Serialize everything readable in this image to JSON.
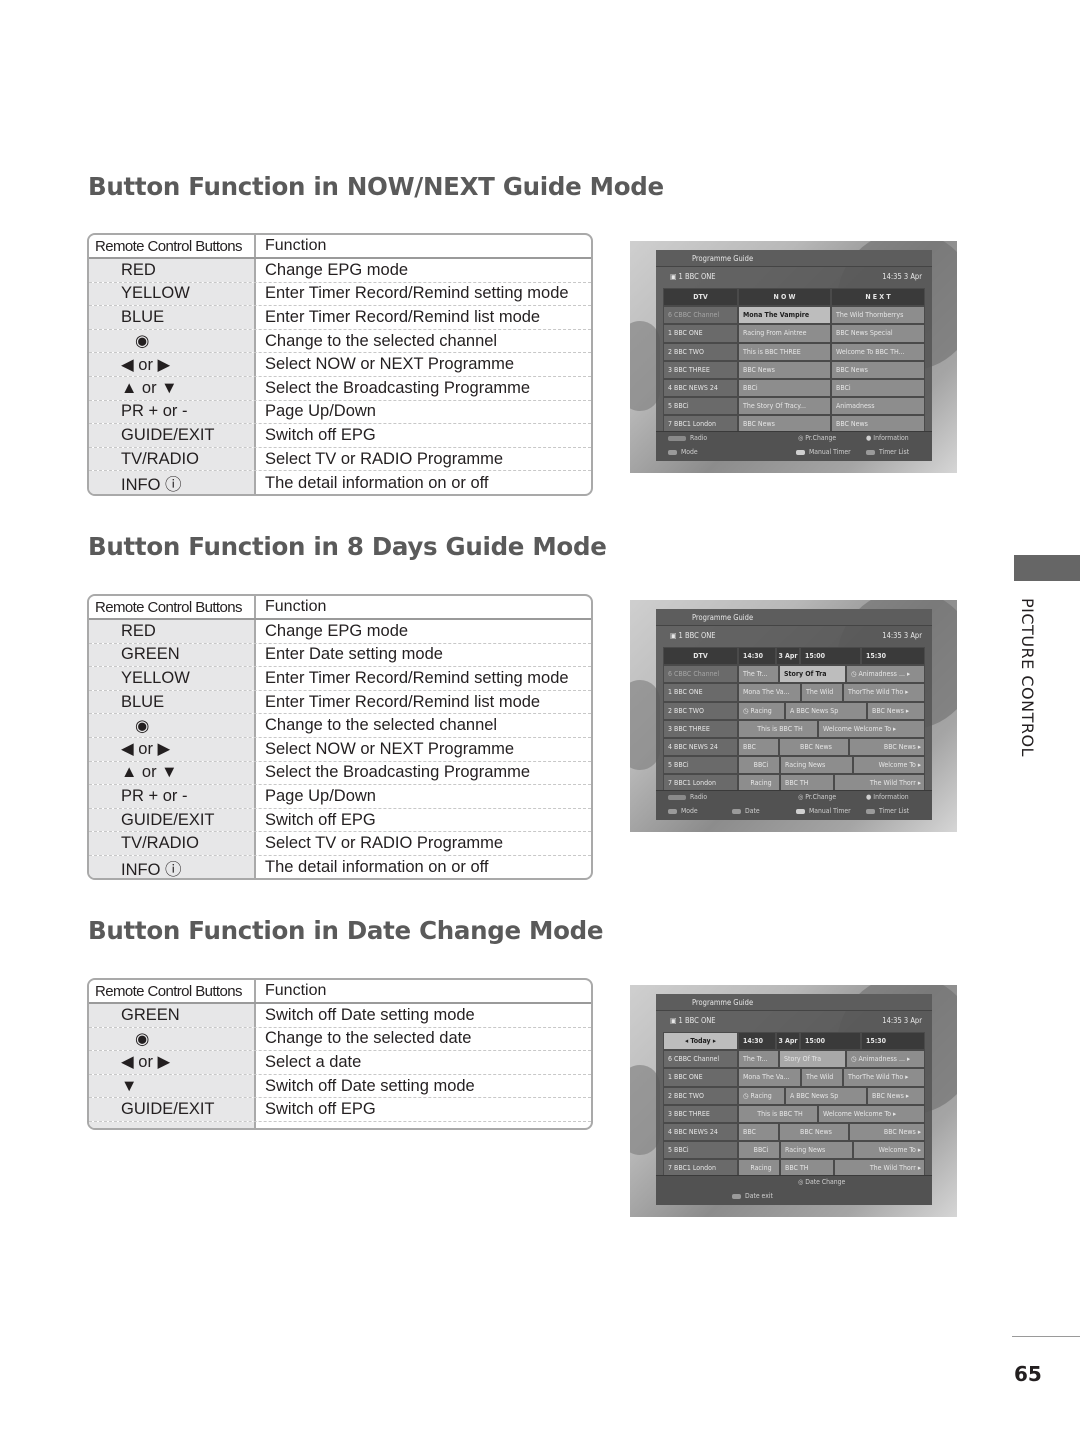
{
  "sections": [
    {
      "title": "Button Function in NOW/NEXT Guide Mode",
      "table": {
        "headers": [
          "Remote Control Buttons",
          "Function"
        ],
        "rows": [
          {
            "button": "RED",
            "function": "Change EPG mode"
          },
          {
            "button": "YELLOW",
            "function": "Enter Timer Record/Remind setting mode"
          },
          {
            "button": "BLUE",
            "function": "Enter Timer Record/Remind list mode"
          },
          {
            "button": "◉",
            "function": "Change to the selected channel"
          },
          {
            "button": "◀ or ▶",
            "function": "Select NOW or NEXT Programme"
          },
          {
            "button": "▲ or ▼",
            "function": "Select the Broadcasting Programme"
          },
          {
            "button": "PR + or -",
            "function": "Page Up/Down"
          },
          {
            "button": "GUIDE/EXIT",
            "function": "Switch off EPG"
          },
          {
            "button": "TV/RADIO",
            "function": "Select TV or RADIO Programme"
          },
          {
            "button": "INFO ⓘ",
            "function": "The detail information on or off"
          }
        ]
      },
      "screen": {
        "title": "Programme Guide",
        "current_channel": "1  BBC ONE",
        "clock": "14:35  3 Apr",
        "header": [
          "DTV",
          "N O W",
          "N E X T"
        ],
        "rows": [
          {
            "channel": "6  CBBC Channel",
            "cells": [
              "Mona The Vampire",
              "The Wild Thornberrys"
            ]
          },
          {
            "channel": "1  BBC ONE",
            "cells": [
              "Racing From Aintree",
              "BBC News Special"
            ]
          },
          {
            "channel": "2  BBC TWO",
            "cells": [
              "This is BBC THREE",
              "Welcome To BBC TH..."
            ]
          },
          {
            "channel": "3  BBC THREE",
            "cells": [
              "BBC News",
              "BBC News"
            ]
          },
          {
            "channel": "4  BBC NEWS 24",
            "cells": [
              "BBCi",
              "BBCi"
            ]
          },
          {
            "channel": "5  BBCi",
            "cells": [
              "The Story Of Tracy...",
              "Animadness"
            ]
          },
          {
            "channel": "7  BBC1 London",
            "cells": [
              "BBC News",
              "BBC News"
            ]
          }
        ],
        "footer": [
          "Radio",
          "Pr.Change",
          "Information",
          "Mode",
          "Manual Timer",
          "Timer List"
        ]
      }
    },
    {
      "title": "Button Function in 8 Days Guide Mode",
      "table": {
        "headers": [
          "Remote Control Buttons",
          "Function"
        ],
        "rows": [
          {
            "button": "RED",
            "function": "Change EPG mode"
          },
          {
            "button": "GREEN",
            "function": "Enter Date setting mode"
          },
          {
            "button": "YELLOW",
            "function": "Enter Timer Record/Remind setting mode"
          },
          {
            "button": "BLUE",
            "function": "Enter Timer Record/Remind list mode"
          },
          {
            "button": "◉",
            "function": "Change to the selected channel"
          },
          {
            "button": "◀ or ▶",
            "function": "Select NOW or NEXT Programme"
          },
          {
            "button": "▲ or ▼",
            "function": "Select the Broadcasting Programme"
          },
          {
            "button": "PR + or -",
            "function": "Page Up/Down"
          },
          {
            "button": "GUIDE/EXIT",
            "function": "Switch off EPG"
          },
          {
            "button": "TV/RADIO",
            "function": "Select TV or RADIO Programme"
          },
          {
            "button": "INFO ⓘ",
            "function": "The detail information on or off"
          }
        ]
      },
      "screen": {
        "title": "Programme Guide",
        "current_channel": "1  BBC ONE",
        "clock": "14:35  3 Apr",
        "header": [
          "DTV",
          "14:30",
          "3 Apr",
          "15:00",
          "15:30"
        ],
        "rows": [
          {
            "channel": "6  CBBC Channel",
            "cells": [
              "The Tr...",
              "Story Of Tra",
              "◷ Animadness ... ▸"
            ]
          },
          {
            "channel": "1  BBC ONE",
            "cells": [
              "Mona The Va...",
              "The Wild",
              "ThorThe Wild Tho ▸"
            ]
          },
          {
            "channel": "2  BBC TWO",
            "cells": [
              "◷ Racing",
              "A  BBC News Sp",
              "BBC News ▸"
            ]
          },
          {
            "channel": "3  BBC THREE",
            "cells": [
              "This is BBC TH",
              "Welcome Welcome To ▸"
            ]
          },
          {
            "channel": "4  BBC NEWS 24",
            "cells": [
              "BBC",
              "BBC News",
              "BBC News ▸"
            ]
          },
          {
            "channel": "5  BBCi",
            "cells": [
              "BBCi",
              "Racing News",
              "Welcome To ▸"
            ]
          },
          {
            "channel": "7  BBC1 London",
            "cells": [
              "Racing",
              "BBC TH",
              "The Wild Thorr ▸"
            ]
          }
        ],
        "footer": [
          "Radio",
          "Pr.Change",
          "Information",
          "Mode",
          "Date",
          "Manual Timer",
          "Timer List"
        ]
      }
    },
    {
      "title": "Button Function in Date Change Mode",
      "table": {
        "headers": [
          "Remote Control Buttons",
          "Function"
        ],
        "rows": [
          {
            "button": "GREEN",
            "function": "Switch off Date setting mode"
          },
          {
            "button": "◉",
            "function": "Change to the selected date"
          },
          {
            "button": "◀ or ▶",
            "function": "Select a date"
          },
          {
            "button": "▼",
            "function": "Switch off Date setting mode"
          },
          {
            "button": "GUIDE/EXIT",
            "function": "Switch off EPG"
          }
        ]
      },
      "screen": {
        "title": "Programme Guide",
        "current_channel": "1  BBC ONE",
        "clock": "14:35  3 Apr",
        "header": [
          "◂  Today  ▸",
          "14:30",
          "3 Apr",
          "15:00",
          "15:30"
        ],
        "rows": [
          {
            "channel": "6  CBBC Channel",
            "cells": [
              "The Tr...",
              "Story Of Tra",
              "◷ Animadness ... ▸"
            ]
          },
          {
            "channel": "1  BBC ONE",
            "cells": [
              "Mona The Va...",
              "The Wild",
              "ThorThe Wild Tho ▸"
            ]
          },
          {
            "channel": "2  BBC TWO",
            "cells": [
              "◷ Racing",
              "A  BBC News Sp",
              "BBC News ▸"
            ]
          },
          {
            "channel": "3  BBC THREE",
            "cells": [
              "This is BBC TH",
              "Welcome Welcome To ▸"
            ]
          },
          {
            "channel": "4  BBC NEWS 24",
            "cells": [
              "BBC",
              "BBC News",
              "BBC News ▸"
            ]
          },
          {
            "channel": "5  BBCi",
            "cells": [
              "BBCi",
              "Racing News",
              "Welcome To ▸"
            ]
          },
          {
            "channel": "7  BBC1 London",
            "cells": [
              "Racing",
              "BBC TH",
              "The Wild Thorr ▸"
            ]
          }
        ],
        "footer": [
          "Date Change",
          "Date exit"
        ]
      }
    }
  ],
  "side_label": "PICTURE CONTROL",
  "page_number": "65"
}
